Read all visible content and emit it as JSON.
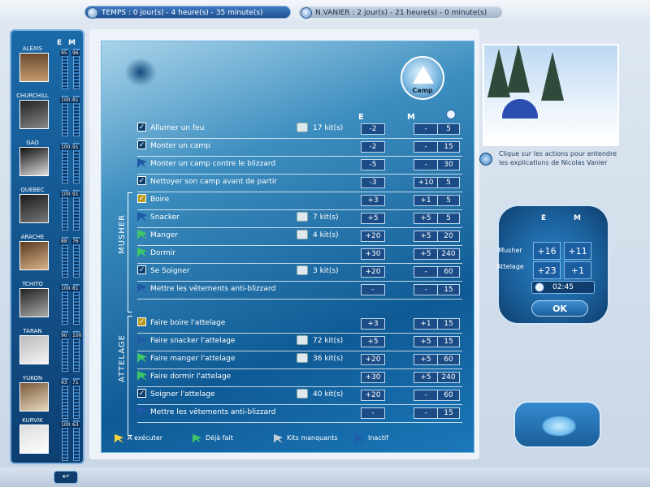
{
  "top": {
    "timer_temps": "TEMPS : 0 jour(s) - 4 heure(s) - 35 minute(s)",
    "timer_vanier": "N.VANIER : 2 jour(s) - 21 heure(s) - 0 minute(s)"
  },
  "dogs": {
    "header_e": "E",
    "header_m": "M",
    "items": [
      {
        "name": "ALEXIS",
        "e": "95",
        "m": "96"
      },
      {
        "name": "CHURCHILL",
        "e": "100",
        "m": "81"
      },
      {
        "name": "GAO",
        "e": "100",
        "m": "91"
      },
      {
        "name": "QUEBEC",
        "e": "100",
        "m": "91"
      },
      {
        "name": "ARACHE",
        "e": "88",
        "m": "76"
      },
      {
        "name": "TCHITO",
        "e": "100",
        "m": "81"
      },
      {
        "name": "TARAN",
        "e": "90",
        "m": "100"
      },
      {
        "name": "YUKON",
        "e": "93",
        "m": "71"
      },
      {
        "name": "KURVIK",
        "e": "100",
        "m": "63"
      }
    ]
  },
  "main": {
    "camp_label": "Camp",
    "col_e": "E",
    "col_m": "M",
    "section_musher": "MUSHER",
    "section_attelage": "ATTELAGE",
    "rows": [
      {
        "marker": "check",
        "label": "Allumer un feu",
        "kits": "17 kit(s)",
        "e": "-2",
        "m": "-",
        "t": "5"
      },
      {
        "marker": "check",
        "label": "Monter un camp",
        "kits": "",
        "e": "-2",
        "m": "-",
        "t": "15"
      },
      {
        "marker": "blue",
        "label": "Monter un camp contre le blizzard",
        "kits": "",
        "e": "-5",
        "m": "-",
        "t": "30"
      },
      {
        "marker": "check",
        "label": "Nettoyer son camp avant de partir",
        "kits": "",
        "e": "-3",
        "m": "+10",
        "t": "5"
      },
      {
        "marker": "check",
        "label": "Boire",
        "kits": "",
        "e": "+3",
        "m": "+1",
        "t": "5"
      },
      {
        "marker": "blue",
        "label": "Snacker",
        "kits": "7 kit(s)",
        "e": "+5",
        "m": "+5",
        "t": "5"
      },
      {
        "marker": "green",
        "label": "Manger",
        "kits": "4 kit(s)",
        "e": "+20",
        "m": "+5",
        "t": "20"
      },
      {
        "marker": "green",
        "label": "Dormir",
        "kits": "",
        "e": "+30",
        "m": "+5",
        "t": "240"
      },
      {
        "marker": "check",
        "label": "Se Soigner",
        "kits": "3 kit(s)",
        "e": "+20",
        "m": "-",
        "t": "60"
      },
      {
        "marker": "blue",
        "label": "Mettre les vêtements anti-blizzard",
        "kits": "",
        "e": "-",
        "m": "-",
        "t": "15"
      },
      {
        "marker": "check",
        "label": "Faire boire l'attelage",
        "kits": "",
        "e": "+3",
        "m": "+1",
        "t": "15"
      },
      {
        "marker": "blue",
        "label": "Faire snacker l'attelage",
        "kits": "72 kit(s)",
        "e": "+5",
        "m": "+5",
        "t": "15"
      },
      {
        "marker": "green",
        "label": "Faire manger l'attelage",
        "kits": "36 kit(s)",
        "e": "+20",
        "m": "+5",
        "t": "60"
      },
      {
        "marker": "green",
        "label": "Faire dormir l'attelage",
        "kits": "",
        "e": "+30",
        "m": "+5",
        "t": "240"
      },
      {
        "marker": "check",
        "label": "Soigner l'attelage",
        "kits": "40 kit(s)",
        "e": "+20",
        "m": "-",
        "t": "60"
      },
      {
        "marker": "blue",
        "label": "Mettre les vêtements anti-blizzard",
        "kits": "",
        "e": "-",
        "m": "-",
        "t": "15"
      }
    ],
    "legend": {
      "a_executer": "A exécuter",
      "deja_fait": "Déjà fait",
      "kits_manquants": "Kits manquants",
      "inactif": "Inactif"
    }
  },
  "right": {
    "hint": "Clique sur les actions pour entendre les explications de Nicolas Vanier",
    "gauge": {
      "head_e": "E",
      "head_m": "M",
      "musher_label": "Musher",
      "attelage_label": "Attelage",
      "musher_e": "+16",
      "musher_m": "+11",
      "attelage_e": "+23",
      "attelage_m": "+1",
      "time": "02:45",
      "ok": "OK"
    }
  },
  "colors": {
    "accent": "#1a5e99",
    "arrow_yellow": "#f1d23d",
    "arrow_green": "#3fc46a",
    "arrow_grey": "#c7cfd8",
    "arrow_blue": "#1f5aa8"
  }
}
